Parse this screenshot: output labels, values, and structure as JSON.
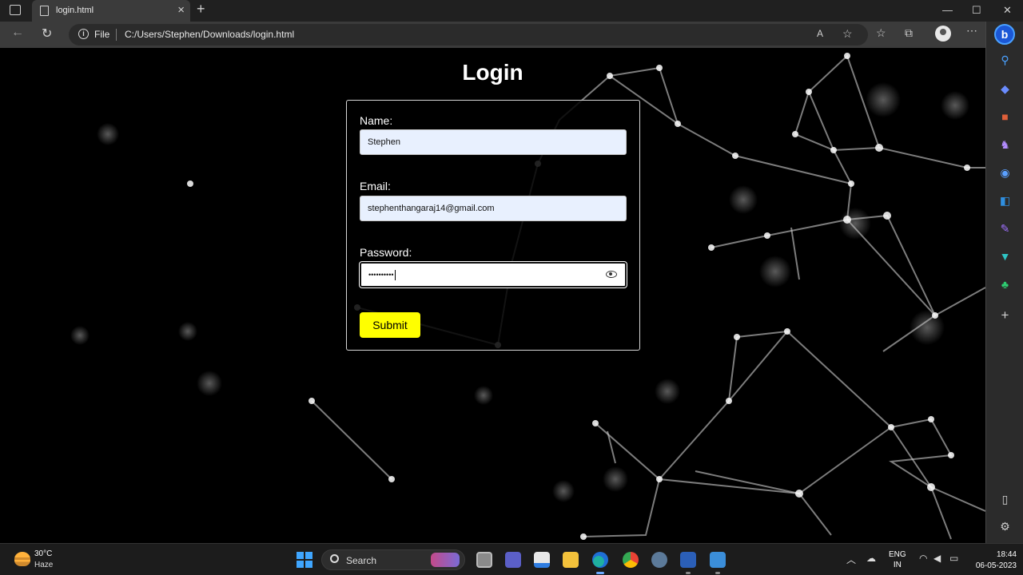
{
  "browser": {
    "tab_title": "login.html",
    "address_scheme": "File",
    "address_url": "C:/Users/Stephen/Downloads/login.html"
  },
  "page": {
    "title": "Login",
    "form": {
      "name_label": "Name:",
      "name_value": "Stephen",
      "email_label": "Email:",
      "email_value": "stephenthangaraj14@gmail.com",
      "password_label": "Password:",
      "password_masked": "••••••••••",
      "submit_label": "Submit"
    },
    "colors": {
      "submit_bg": "#ffff00",
      "autofill_bg": "#e8f0fe"
    }
  },
  "taskbar": {
    "weather_temp": "30°C",
    "weather_condition": "Haze",
    "search_label": "Search",
    "lang_top": "ENG",
    "lang_bottom": "IN",
    "time": "18:44",
    "date": "06-05-2023"
  }
}
